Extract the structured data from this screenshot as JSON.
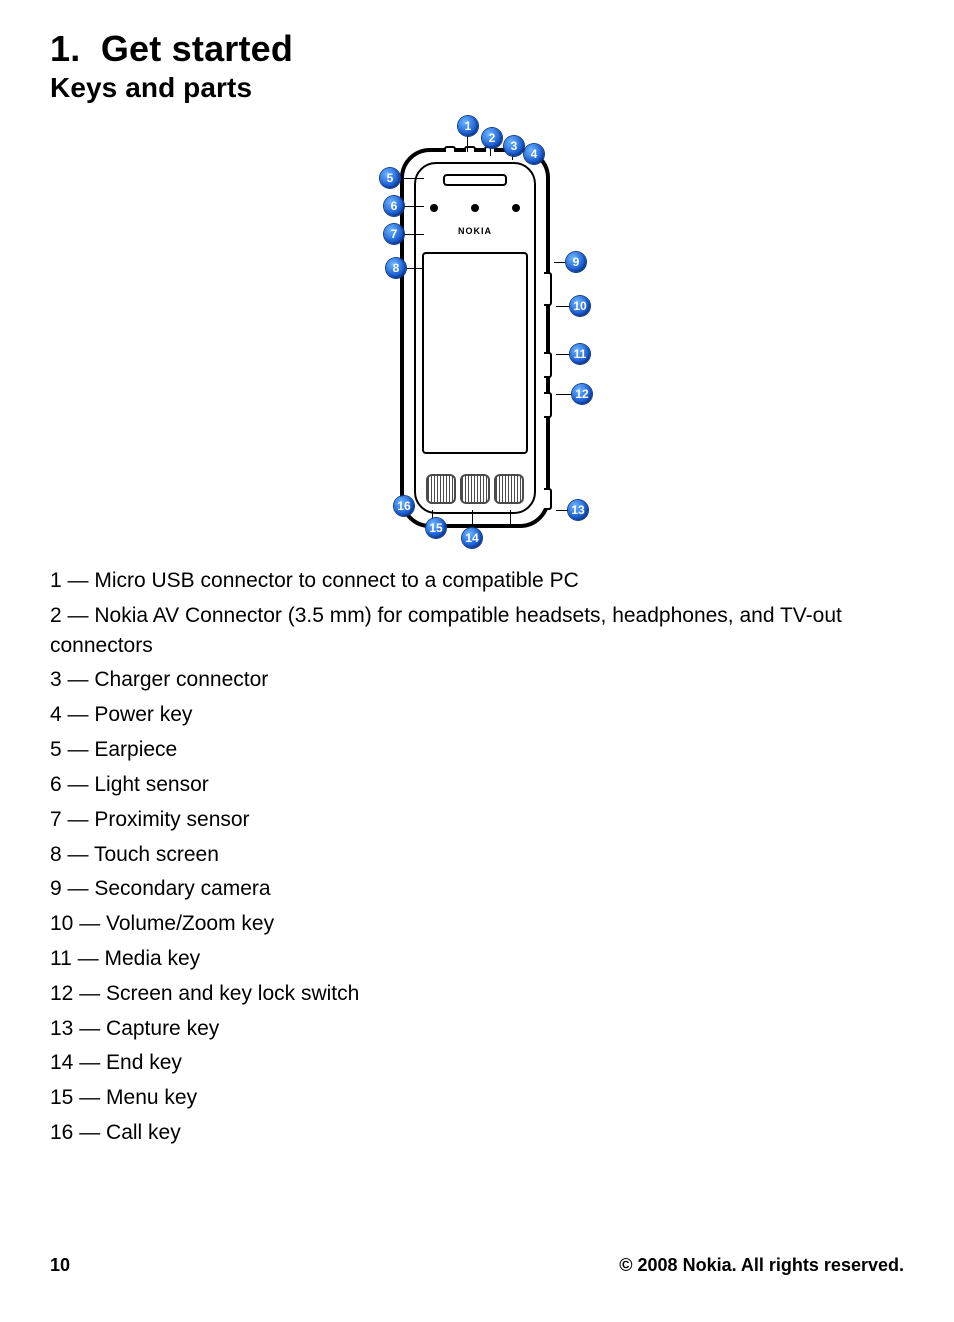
{
  "heading": {
    "number": "1.",
    "title": "Get started",
    "subtitle": "Keys and parts"
  },
  "brand_label": "NOKIA",
  "callouts": {
    "c1": "1",
    "c2": "2",
    "c3": "3",
    "c4": "4",
    "c5": "5",
    "c6": "6",
    "c7": "7",
    "c8": "8",
    "c9": "9",
    "c10": "10",
    "c11": "11",
    "c12": "12",
    "c13": "13",
    "c14": "14",
    "c15": "15",
    "c16": "16"
  },
  "parts": [
    "1 — Micro USB connector to connect to a compatible PC",
    "2 — Nokia AV Connector (3.5 mm) for compatible headsets, headphones, and TV-out connectors",
    "3 — Charger connector",
    "4 — Power key",
    "5 — Earpiece",
    "6 — Light sensor",
    "7 — Proximity sensor",
    "8 — Touch screen",
    "9 — Secondary camera",
    "10 — Volume/Zoom key",
    "11 — Media key",
    "12 — Screen and key lock switch",
    "13 — Capture key",
    "14 — End key",
    "15 — Menu key",
    "16 — Call key"
  ],
  "footer": {
    "page": "10",
    "copyright": "© 2008 Nokia. All rights reserved."
  }
}
